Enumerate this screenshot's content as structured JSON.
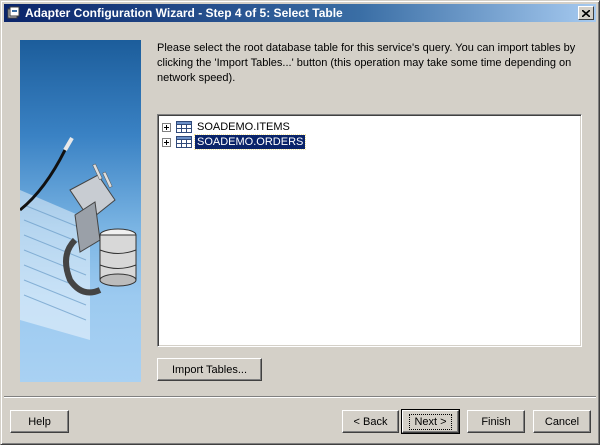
{
  "window": {
    "title": "Adapter Configuration Wizard - Step 4 of 5: Select Table"
  },
  "instructions": "Please select the root database table for this service's query.  You can import tables by clicking the 'Import Tables...' button (this operation may take some time depending on network speed).",
  "tree": {
    "items": [
      {
        "label": "SOADEMO.ITEMS",
        "selected": false
      },
      {
        "label": "SOADEMO.ORDERS",
        "selected": true
      }
    ]
  },
  "buttons": {
    "import_tables": "Import Tables...",
    "help": "Help",
    "back": "< Back",
    "next": "Next >",
    "finish": "Finish",
    "cancel": "Cancel"
  },
  "colors": {
    "title_bar_start": "#0a246a",
    "title_bar_end": "#a6caf0",
    "selection": "#0a246a",
    "dialog_face": "#d4d0c8"
  },
  "icons": {
    "title": "adapter-wizard-icon",
    "close": "close-icon",
    "tree_item": "table-icon",
    "expander": "expand-plus-icon"
  }
}
